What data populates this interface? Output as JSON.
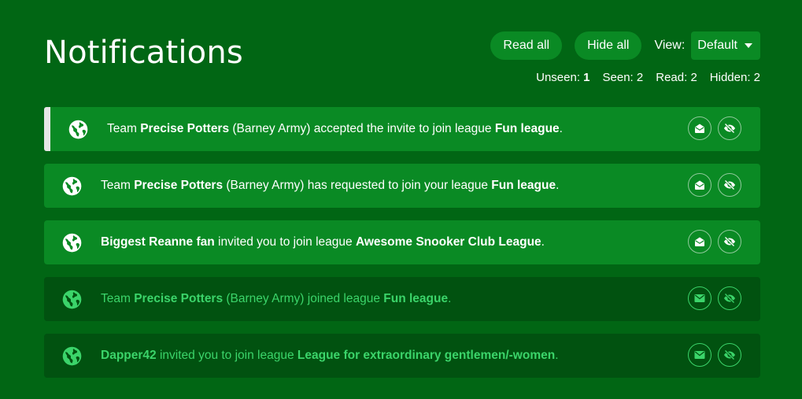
{
  "page": {
    "title": "Notifications"
  },
  "toolbar": {
    "read_all_label": "Read all",
    "hide_all_label": "Hide all",
    "view_label": "View:",
    "view_selected": "Default"
  },
  "counts": {
    "unseen_label": "Unseen:",
    "unseen": "1",
    "seen_label": "Seen:",
    "seen": "2",
    "read_label": "Read:",
    "read": "2",
    "hidden_label": "Hidden:",
    "hidden": "2"
  },
  "colors": {
    "background": "#016614",
    "unread_row": "#0a8a24",
    "read_row": "#015210",
    "read_text": "#3bd46a",
    "active_marker": "#e6e6e6"
  },
  "notifications": [
    {
      "state": "unseen",
      "icon": "globe-icon",
      "parts": [
        "Team ",
        "Precise Potters",
        " (Barney Army) accepted the invite to join league ",
        "Fun league",
        "."
      ]
    },
    {
      "state": "seen",
      "icon": "globe-icon",
      "parts": [
        "Team ",
        "Precise Potters",
        " (Barney Army) has requested to join your league ",
        "Fun league",
        "."
      ]
    },
    {
      "state": "seen",
      "icon": "globe-icon",
      "parts": [
        "",
        "Biggest Reanne fan",
        " invited you to join league ",
        "Awesome Snooker Club League",
        "."
      ]
    },
    {
      "state": "read",
      "icon": "globe-icon",
      "parts": [
        "Team ",
        "Precise Potters",
        " (Barney Army) joined league ",
        "Fun league",
        "."
      ]
    },
    {
      "state": "read",
      "icon": "globe-icon",
      "parts": [
        "",
        "Dapper42",
        " invited you to join league ",
        "League for extraordinary gentlemen/-women",
        "."
      ]
    }
  ]
}
